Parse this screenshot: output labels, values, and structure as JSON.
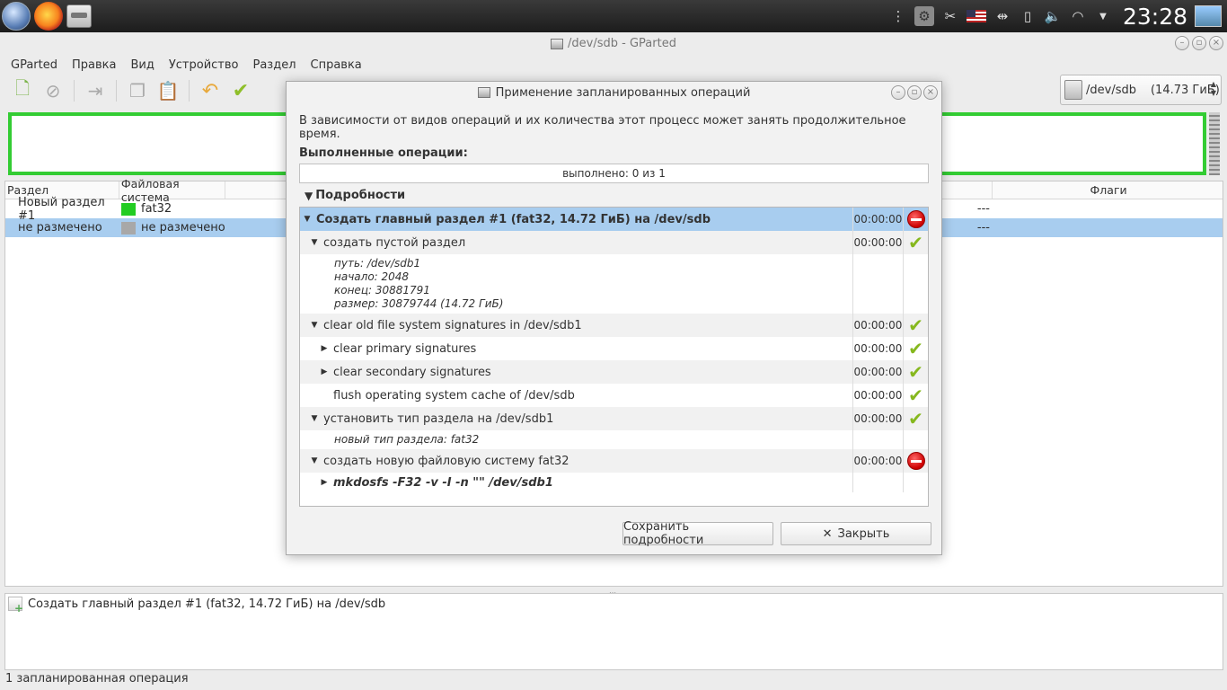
{
  "panel": {
    "clock": "23:28",
    "tray_icons": [
      "settings-icon",
      "scissors-icon",
      "keyboard-layout-icon",
      "usb-icon",
      "battery-icon",
      "volume-icon",
      "wifi-icon",
      "dropdown-icon"
    ]
  },
  "window": {
    "title": "/dev/sdb - GParted"
  },
  "menubar": {
    "items": [
      "GParted",
      "Правка",
      "Вид",
      "Устройство",
      "Раздел",
      "Справка"
    ]
  },
  "device": {
    "name": "/dev/sdb",
    "size": "(14.73 ГиБ)"
  },
  "partition_table": {
    "columns": [
      "Раздел",
      "Файловая система",
      "Флаги"
    ],
    "rows": [
      {
        "partition": "Новый раздел #1",
        "filesystem": "fat32",
        "color": "#22cc22",
        "flags_col": "---"
      },
      {
        "partition": "не размечено",
        "filesystem": "не размечено",
        "color": "#a8a8a8",
        "flags_col": "---"
      }
    ]
  },
  "pending_ops": {
    "items": [
      "Создать главный раздел #1 (fat32, 14.72 ГиБ) на /dev/sdb"
    ]
  },
  "statusbar": "1 запланированная операция",
  "dialog": {
    "title": "Применение запланированных операций",
    "description": "В зависимости от видов операций и их количества этот процесс может занять продолжительное время.",
    "done_label": "Выполненные операции:",
    "progress_text": "выполнено: 0 из 1",
    "details_label": "Подробности",
    "tree": [
      {
        "label": "Создать главный раздел #1 (fat32, 14.72 ГиБ) на /dev/sdb",
        "time": "00:00:00",
        "status": "error"
      },
      {
        "label": "создать пустой раздел",
        "time": "00:00:00",
        "status": "ok"
      },
      {
        "info": [
          "путь: /dev/sdb1",
          "начало: 2048",
          "конец: 30881791",
          "размер: 30879744 (14.72 ГиБ)"
        ]
      },
      {
        "label": "clear old file system signatures in /dev/sdb1",
        "time": "00:00:00",
        "status": "ok"
      },
      {
        "label": "clear primary signatures",
        "time": "00:00:00",
        "status": "ok"
      },
      {
        "label": "clear secondary signatures",
        "time": "00:00:00",
        "status": "ok"
      },
      {
        "label": "flush operating system cache of /dev/sdb",
        "time": "00:00:00",
        "status": "ok"
      },
      {
        "label": "установить тип раздела на /dev/sdb1",
        "time": "00:00:00",
        "status": "ok"
      },
      {
        "info": [
          "новый тип раздела: fat32"
        ]
      },
      {
        "label": "создать новую файловую систему fat32",
        "time": "00:00:00",
        "status": "error"
      },
      {
        "label": "mkdosfs -F32 -v -I -n \"\" /dev/sdb1",
        "time": "",
        "status": ""
      }
    ],
    "save_button": "Сохранить подробности",
    "close_button": "Закрыть"
  }
}
